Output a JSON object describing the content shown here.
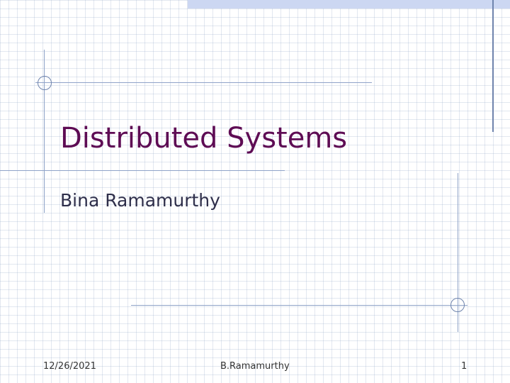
{
  "slide": {
    "title": "Distributed Systems",
    "subtitle": "Bina Ramamurthy",
    "footer": {
      "date": "12/26/2021",
      "author": "B.Ramamurthy",
      "page_number": "1"
    }
  },
  "colors": {
    "title": "#5e0c54",
    "accent_bar": "#ccd7f2",
    "rule_lines": "#8fa3c8"
  }
}
